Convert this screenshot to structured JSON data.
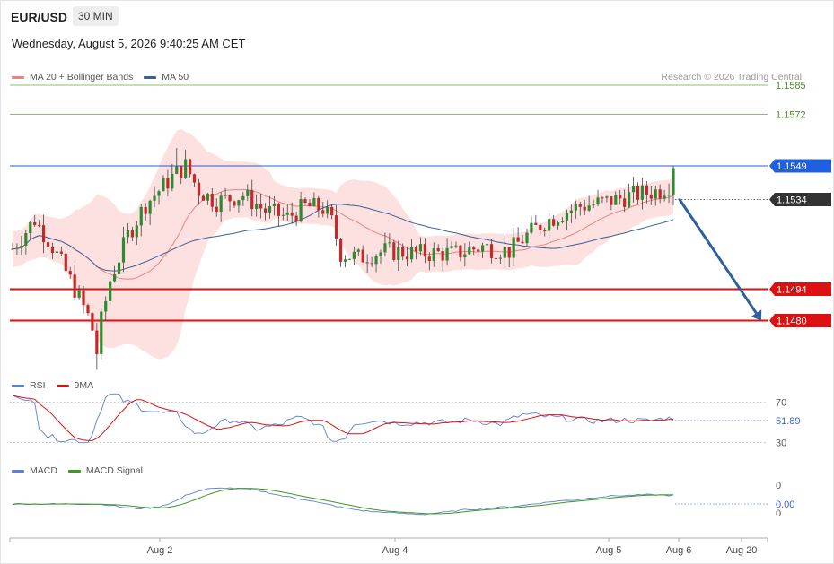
{
  "header": {
    "symbol": "EUR/USD",
    "timeframe": "30 MIN",
    "datetime": "Wednesday, August 5, 2026 9:40:25 AM CET"
  },
  "credit": "Research © 2026 Trading Central",
  "legends": {
    "price": [
      {
        "name": "MA 20 + Bollinger Bands",
        "color": "#f08080"
      },
      {
        "name": "MA 50",
        "color": "#3a5f9a"
      }
    ],
    "rsi": [
      {
        "name": "RSI",
        "color": "#5b7fd6"
      },
      {
        "name": "9MA",
        "color": "#dd1111"
      }
    ],
    "macd": [
      {
        "name": "MACD",
        "color": "#5b7fd6"
      },
      {
        "name": "MACD Signal",
        "color": "#3d9a1a"
      }
    ]
  },
  "colors": {
    "bull": "#2f8a2f",
    "bear": "#c62828",
    "band": "#fde0e0",
    "resistance": "#4a8a2a",
    "pivot": "#2060e0",
    "support": "#dd1111",
    "current": "#333333",
    "arrow": "#2f5f9c"
  },
  "chart_data": [
    {
      "type": "candlestick",
      "x_ticks": [
        "Aug 2",
        "Aug 4",
        "Aug 5",
        "Aug 6",
        "Aug 20"
      ],
      "ylim": [
        1.1455,
        1.1595
      ],
      "levels": [
        {
          "value": 1.1585,
          "label": "1.1585",
          "kind": "resistance"
        },
        {
          "value": 1.1572,
          "label": "1.1572",
          "kind": "resistance"
        },
        {
          "value": 1.1549,
          "label": "1.1549",
          "kind": "pivot"
        },
        {
          "value": 1.1534,
          "label": "1.1534",
          "kind": "current"
        },
        {
          "value": 1.1494,
          "label": "1.1494",
          "kind": "support"
        },
        {
          "value": 1.148,
          "label": "1.1480",
          "kind": "support"
        }
      ],
      "projection": {
        "from": 1.1534,
        "to": 1.148
      }
    },
    {
      "type": "line",
      "name": "RSI",
      "ylim": [
        20,
        80
      ],
      "ticks": [
        70,
        30
      ],
      "current_value": "51.89"
    },
    {
      "type": "line",
      "name": "MACD",
      "ticks": [
        0,
        0
      ],
      "current_value": "0.00"
    }
  ]
}
